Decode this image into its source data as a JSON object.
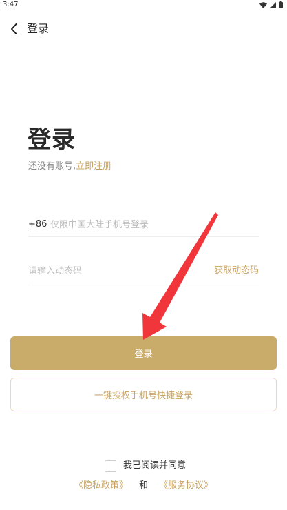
{
  "status_bar": {
    "time": "3:47"
  },
  "header": {
    "title": "登录"
  },
  "main": {
    "title": "登录",
    "register_prompt": "还没有账号,",
    "register_link": "立即注册",
    "phone": {
      "country_code": "+86",
      "placeholder": "仅限中国大陆手机号登录",
      "value": ""
    },
    "code": {
      "placeholder": "请输入动态码",
      "value": "",
      "get_code_label": "获取动态码"
    },
    "login_button": "登录",
    "quick_login_button": "一键授权手机号快捷登录"
  },
  "agreement": {
    "checked": false,
    "text": "我已阅读并同意",
    "privacy_link": "《隐私政策》",
    "and": "和",
    "service_link": "《服务协议》"
  },
  "colors": {
    "accent": "#c9ac6a",
    "link": "#c9a464",
    "annotation_arrow": "#f0353b"
  }
}
